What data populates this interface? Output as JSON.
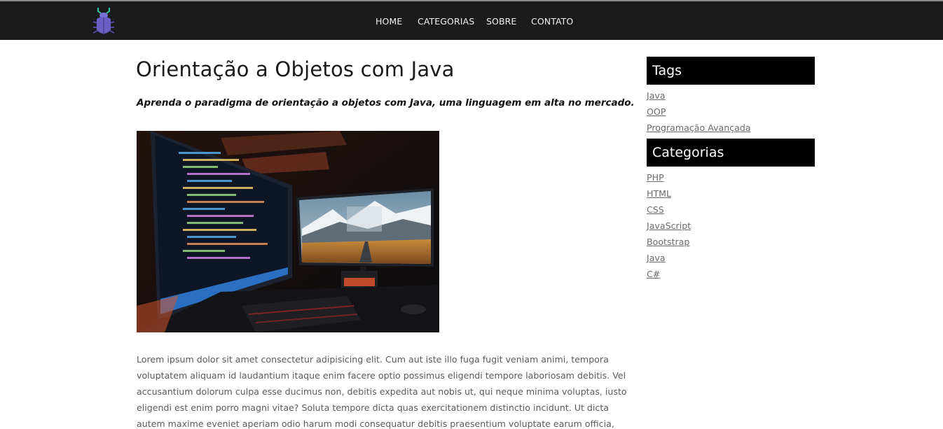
{
  "nav": {
    "items": [
      {
        "label": "HOME"
      },
      {
        "label": "CATEGORIAS"
      },
      {
        "label": "SOBRE"
      },
      {
        "label": "CONTATO"
      }
    ]
  },
  "post": {
    "title": "Orientação a Objetos com Java",
    "subtitle": "Aprenda o paradigma de orientação a objetos com Java, uma linguagem em alta no mercado.",
    "body": "Lorem ipsum dolor sit amet consectetur adipisicing elit. Cum aut iste illo fuga fugit veniam animi, tempora voluptatem aliquam id laudantium itaque enim facere optio possimus eligendi tempore laboriosam debitis. Vel accusantium dolorum culpa esse ducimus non, debitis expedita aut nobis ut, qui neque minima voluptas, iusto eligendi est enim porro magni vitae? Soluta tempore dicta quas exercitationem distinctio incidunt. Ut dicta autem maxime eveniet aperiam odio harum modi consequatur debitis praesentium voluptate earum officia,"
  },
  "sidebar": {
    "tags": {
      "title": "Tags",
      "items": [
        "Java",
        "OOP",
        "Programação Avançada"
      ]
    },
    "categories": {
      "title": "Categorias",
      "items": [
        "PHP",
        "HTML",
        "CSS",
        "JavaScript",
        "Bootstrap",
        "Java",
        "C#"
      ]
    }
  },
  "colors": {
    "navbar": "#1b1b1b",
    "logo": "#6b5fc4",
    "logo_antenna": "#36c9a8",
    "sidebar_heading": "#000000"
  }
}
